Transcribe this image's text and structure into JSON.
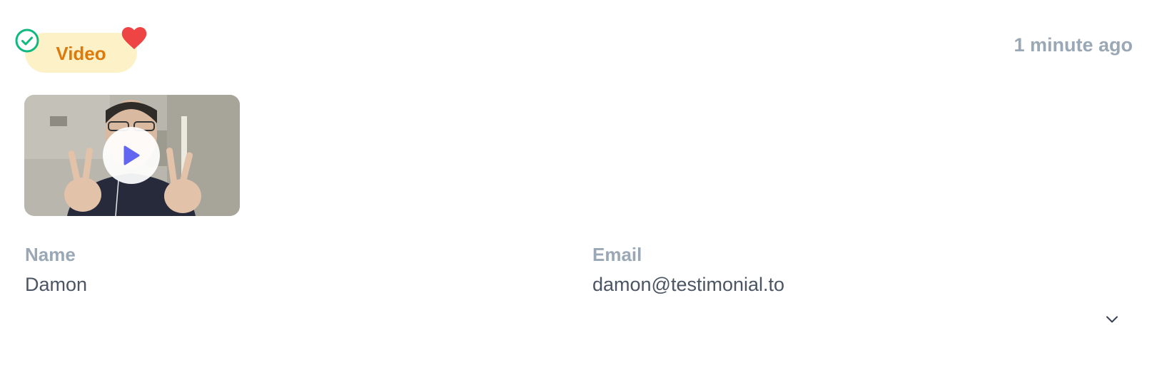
{
  "testimonial": {
    "type_label": "Video",
    "timestamp": "1 minute ago",
    "approved": true,
    "liked": true,
    "fields": {
      "name_label": "Name",
      "name_value": "Damon",
      "email_label": "Email",
      "email_value": "damon@testimonial.to"
    }
  },
  "icons": {
    "approved": "check-circle-icon",
    "liked": "heart-icon",
    "play": "play-icon",
    "expand": "chevron-down-icon"
  },
  "colors": {
    "badge_bg": "#fdf1c7",
    "badge_text": "#dc7a0c",
    "approved_green": "#10b981",
    "heart_red": "#ef4444",
    "play_accent": "#6366f1",
    "muted_label": "#9aa7b4",
    "value_text": "#4b5563"
  }
}
